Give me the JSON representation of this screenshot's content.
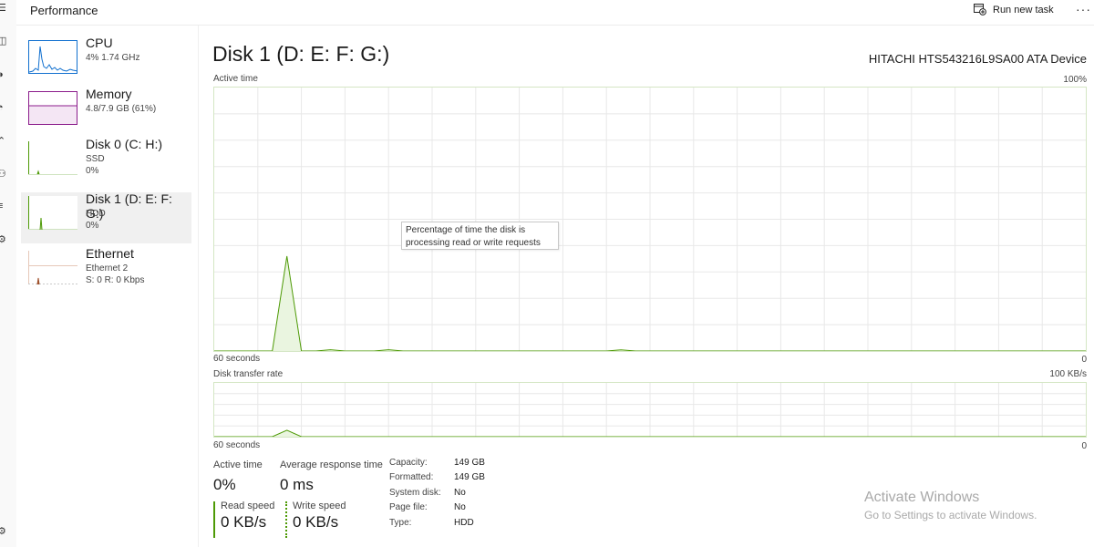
{
  "header": {
    "title": "Performance",
    "run_new_task": "Run new task",
    "more": "···"
  },
  "sidebar": {
    "items": [
      {
        "name": "CPU",
        "line1": "4%  1.74 GHz",
        "line2": "",
        "selected": false,
        "color": "#1170cf"
      },
      {
        "name": "Memory",
        "line1": "4.8/7.9 GB (61%)",
        "line2": "",
        "selected": false,
        "color": "#8b1c8b"
      },
      {
        "name": "Disk 0 (C: H:)",
        "line1": "SSD",
        "line2": "0%",
        "selected": false,
        "color": "#4e9a06"
      },
      {
        "name": "Disk 1 (D: E: F: G:)",
        "line1": "HDD",
        "line2": "0%",
        "selected": true,
        "color": "#4e9a06"
      },
      {
        "name": "Ethernet",
        "line1": "Ethernet 2",
        "line2": "S: 0  R: 0 Kbps",
        "selected": false,
        "color": "#a0522d"
      }
    ]
  },
  "main": {
    "title": "Disk 1 (D: E: F: G:)",
    "device": "HITACHI HTS543216L9SA00 ATA Device",
    "active_graph": {
      "label": "Active time",
      "max_label": "100%",
      "time_label": "60 seconds",
      "min_label": "0",
      "tooltip": {
        "line1": "Percentage of time the disk is",
        "line2": "processing read or write requests"
      }
    },
    "transfer_graph": {
      "label": "Disk transfer rate",
      "max_label": "100 KB/s",
      "time_label": "60 seconds",
      "min_label": "0"
    },
    "stats": {
      "active_time_label": "Active time",
      "active_time_value": "0%",
      "avg_response_label": "Average response time",
      "avg_response_value": "0 ms",
      "read_speed_label": "Read speed",
      "read_speed_value": "0 KB/s",
      "write_speed_label": "Write speed",
      "write_speed_value": "0 KB/s"
    },
    "properties": [
      {
        "key": "Capacity:",
        "value": "149 GB"
      },
      {
        "key": "Formatted:",
        "value": "149 GB"
      },
      {
        "key": "System disk:",
        "value": "No"
      },
      {
        "key": "Page file:",
        "value": "No"
      },
      {
        "key": "Type:",
        "value": "HDD"
      }
    ]
  },
  "watermark": {
    "line1": "Activate Windows",
    "line2": "Go to Settings to activate Windows."
  },
  "colors": {
    "disk_line": "#4e9a06",
    "disk_fill": "#eaf5e0",
    "grid": "#e8e8e8"
  },
  "chart_data": [
    {
      "type": "area",
      "title": "Active time",
      "ylabel": "Active time (%)",
      "xlabel": "60 seconds",
      "ylim": [
        0,
        100
      ],
      "x": [
        60,
        58,
        57,
        56,
        55,
        54,
        53,
        52,
        51,
        49,
        48,
        47,
        46,
        33,
        32,
        31,
        30,
        0
      ],
      "values": [
        0,
        0,
        0,
        0,
        36,
        0,
        0,
        0.5,
        0,
        0,
        0.5,
        0,
        0,
        0,
        0.4,
        0,
        0,
        0
      ],
      "xlim": [
        60,
        0
      ],
      "grid": true
    },
    {
      "type": "area",
      "title": "Disk transfer rate",
      "ylabel": "KB/s",
      "xlabel": "60 seconds",
      "ylim": [
        0,
        100
      ],
      "x": [
        60,
        57,
        56,
        55,
        54,
        53,
        0
      ],
      "values": [
        0,
        0,
        0,
        12,
        0,
        0,
        0
      ],
      "xlim": [
        60,
        0
      ],
      "grid": true
    }
  ]
}
